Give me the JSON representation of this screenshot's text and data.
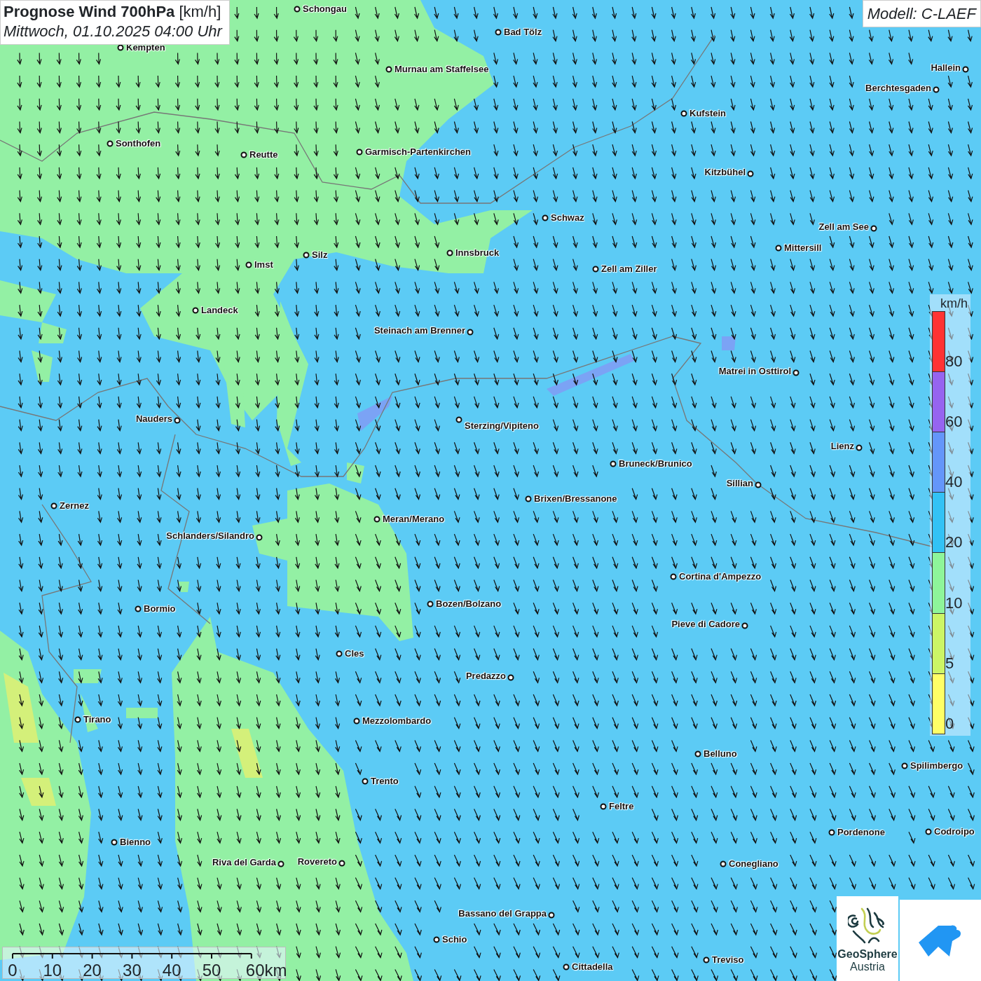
{
  "title": {
    "main": "Prognose Wind 700hPa",
    "unit": "[km/h]",
    "time": "Mittwoch, 01.10.2025 04:00 Uhr"
  },
  "model": "Modell: C-LAEF",
  "cities": [
    {
      "name": "Schongau"
    },
    {
      "name": "Kempten"
    },
    {
      "name": "Bad Tölz"
    },
    {
      "name": "Murnau am Staffelsee"
    },
    {
      "name": "Hallein"
    },
    {
      "name": "Berchtesgaden"
    },
    {
      "name": "Kufstein"
    },
    {
      "name": "Sonthofen"
    },
    {
      "name": "Reutte"
    },
    {
      "name": "Garmisch-Partenkirchen"
    },
    {
      "name": "Kitzbühel"
    },
    {
      "name": "Schwaz"
    },
    {
      "name": "Zell am See"
    },
    {
      "name": "Innsbruck"
    },
    {
      "name": "Mittersill"
    },
    {
      "name": "Silz"
    },
    {
      "name": "Imst"
    },
    {
      "name": "Zell am Ziller"
    },
    {
      "name": "Landeck"
    },
    {
      "name": "Steinach am Brenner"
    },
    {
      "name": "Matrei in Osttirol"
    },
    {
      "name": "Nauders"
    },
    {
      "name": "Sterzing/Vipiteno"
    },
    {
      "name": "Lienz"
    },
    {
      "name": "Bruneck/Brunico"
    },
    {
      "name": "Sillian"
    },
    {
      "name": "Brixen/Bressanone"
    },
    {
      "name": "Zernez"
    },
    {
      "name": "Meran/Merano"
    },
    {
      "name": "Schlanders/Silandro"
    },
    {
      "name": "Cortina d'Ampezzo"
    },
    {
      "name": "Bozen/Bolzano"
    },
    {
      "name": "Bormio"
    },
    {
      "name": "Pieve di Cadore"
    },
    {
      "name": "Cles"
    },
    {
      "name": "Predazzo"
    },
    {
      "name": "Tirano"
    },
    {
      "name": "Mezzolombardo"
    },
    {
      "name": "Belluno"
    },
    {
      "name": "Spilimbergo"
    },
    {
      "name": "Trento"
    },
    {
      "name": "Feltre"
    },
    {
      "name": "Pordenone"
    },
    {
      "name": "Codroipo"
    },
    {
      "name": "Bienno"
    },
    {
      "name": "Riva del Garda"
    },
    {
      "name": "Rovereto"
    },
    {
      "name": "Conegliano"
    },
    {
      "name": "Bassano del Grappa"
    },
    {
      "name": "Schio"
    },
    {
      "name": "Treviso"
    },
    {
      "name": "Cittadella"
    }
  ],
  "legend": {
    "unit": "km/h",
    "segments": [
      {
        "label": "80",
        "color": "#ff3333"
      },
      {
        "label": "60",
        "color": "#9664f0"
      },
      {
        "label": "40",
        "color": "#6496fa"
      },
      {
        "label": "20",
        "color": "#33c2f5"
      },
      {
        "label": "10",
        "color": "#8ef59a"
      },
      {
        "label": "5",
        "color": "#ccf566"
      },
      {
        "label": "0",
        "color": "#ffff66"
      }
    ]
  },
  "scale_bar": {
    "labels": [
      "0",
      "10",
      "20",
      "30",
      "40",
      "50",
      "60km"
    ]
  },
  "logos": {
    "name": "GeoSphere",
    "subtitle": "Austria"
  }
}
